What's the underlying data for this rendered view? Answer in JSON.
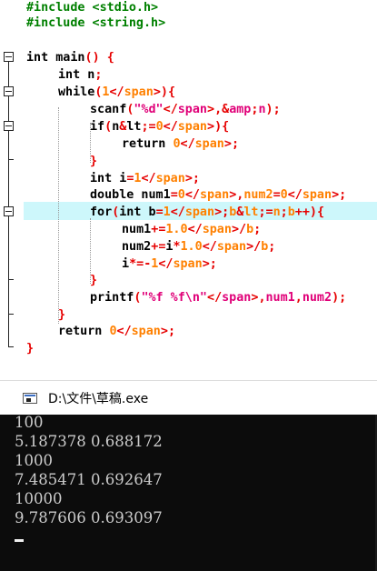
{
  "editor": {
    "lines": [
      [
        "#include <stdio.h>"
      ],
      [
        "#include <string.h>"
      ],
      [
        ""
      ],
      [
        "int main() {"
      ],
      [
        "int n;"
      ],
      [
        "while(1){"
      ],
      [
        "scanf(\"%d\",&n);"
      ],
      [
        "if(n<=0){"
      ],
      [
        "return 0;"
      ],
      [
        "}"
      ],
      [
        "int i=1;"
      ],
      [
        "double num1=0,num2=0;"
      ],
      [
        "for(int b=1;b<=n;b++){"
      ],
      [
        "num1+=1.0/b;"
      ],
      [
        "num2+=i*1.0/b;"
      ],
      [
        "i*=-1;"
      ],
      [
        "}"
      ],
      [
        "printf(\"%f %f\\n\",num1,num2);"
      ],
      [
        "}"
      ],
      [
        "return 0;"
      ],
      [
        "}"
      ]
    ]
  },
  "console": {
    "title": "D:\\文件\\草稿.exe",
    "output": [
      "100",
      "5.187378 0.688172",
      "1000",
      "7.485471 0.692647",
      "10000",
      "9.787606 0.693097"
    ]
  }
}
